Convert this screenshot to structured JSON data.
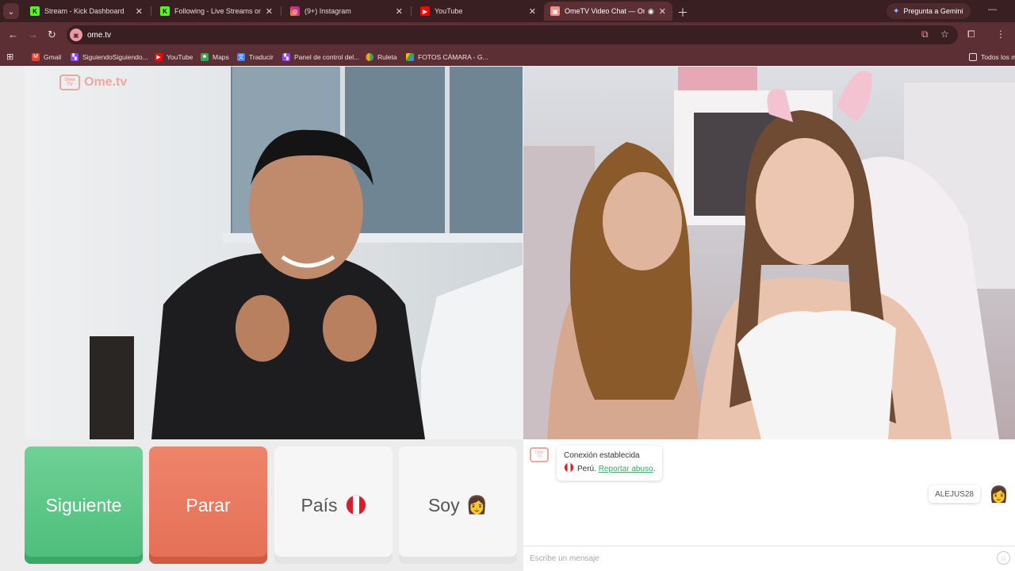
{
  "browser": {
    "tabs": [
      {
        "title": "Stream - Kick Dashboard",
        "favicon": "kick-icon",
        "active": false
      },
      {
        "title": "Following - Live Streams on Kick",
        "favicon": "kick-icon",
        "active": false
      },
      {
        "title": "(9+) Instagram",
        "favicon": "instagram-icon",
        "active": false
      },
      {
        "title": "YouTube",
        "favicon": "youtube-icon",
        "active": false
      },
      {
        "title": "OmeTV Video Chat — Ome",
        "favicon": "ometv-icon",
        "active": true
      }
    ],
    "gemini_label": "Pregunta a Gemini",
    "url": "ome.tv",
    "bookmarks": [
      {
        "label": "Gmail",
        "icon": "gmail-icon"
      },
      {
        "label": "SiguiendoSiguiendo...",
        "icon": "twitch-icon"
      },
      {
        "label": "YouTube",
        "icon": "youtube-icon"
      },
      {
        "label": "Maps",
        "icon": "maps-icon"
      },
      {
        "label": "Traducir",
        "icon": "translate-icon"
      },
      {
        "label": "Panel de control del...",
        "icon": "twitch-icon"
      },
      {
        "label": "Ruleta",
        "icon": "roulette-icon"
      },
      {
        "label": "FOTOS CÁMARA - G...",
        "icon": "drive-icon"
      }
    ],
    "all_bookmarks_label": "Todos los m"
  },
  "page": {
    "logo_text": "Ome.tv",
    "logo_badge": "Ome TV",
    "buttons": {
      "next": "Siguiente",
      "stop": "Parar",
      "country": "País",
      "gender": "Soy"
    },
    "chat": {
      "system_status": "Conexión establecida",
      "country": "Perú.",
      "report_link": "Reportar abuso",
      "stranger_name": "ALEJUS28",
      "input_placeholder": "Escribe un mensaje"
    }
  },
  "colors": {
    "next_button": "#4cbd7b",
    "stop_button": "#e46f55",
    "browser_frame": "#5b2f34",
    "link": "#3aa866"
  }
}
